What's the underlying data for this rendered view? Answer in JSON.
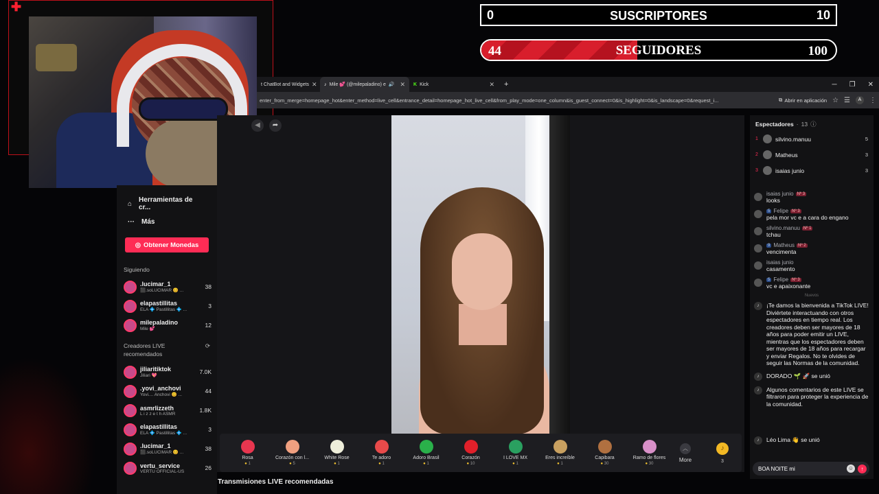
{
  "counters": {
    "subscribers": {
      "current": "0",
      "label": "SUSCRIPTORES",
      "goal": "10"
    },
    "followers": {
      "current": "44",
      "label": "SEGUIDORES",
      "goal": "100",
      "progress": 0.44
    }
  },
  "browser": {
    "tabs": [
      {
        "label": "t ChatBot and Widgets",
        "active": false
      },
      {
        "label": "Mile 💕 (@milepaladino) e",
        "active": true
      },
      {
        "label": "Kick",
        "active": false
      }
    ],
    "url": "enter_from_merge=homepage_hot&enter_method=live_cell&entrance_detail=homepage_hot_live_cell&from_play_mode=one_column&is_guest_connect=0&is_highlight=0&is_landscape=0&request_i...",
    "open_app_label": "Abrir en aplicación"
  },
  "leftnav": {
    "items": [
      {
        "label": "Herramientas de cr...",
        "icon": "home-icon"
      },
      {
        "label": "Más",
        "icon": "ellipsis-icon"
      }
    ],
    "coins_button": "Obtener Monedas",
    "following_title": "Siguiendo",
    "following": [
      {
        "name": ".lucimar_1",
        "sub": "⬛.soLUCIMAR 😊 ...",
        "count": "38"
      },
      {
        "name": "elapastillitas",
        "sub": "ELA 💠 Pastillitas 💠 ...",
        "count": "3"
      },
      {
        "name": "milepaladino",
        "sub": "Mile 💕",
        "count": "12"
      }
    ],
    "recommended_title": "Creadores LIVE recomendados",
    "recommended": [
      {
        "name": "jiliaritiktok",
        "sub": "Jiliari 💖",
        "count": "7.0K"
      },
      {
        "name": ".yovi_anchovi",
        "sub": "Yovi.... Anchovi 😊 ...",
        "count": "44"
      },
      {
        "name": "asmrlizzeth",
        "sub": "L i z z e t h ASMR",
        "count": "1.8K"
      },
      {
        "name": "elapastillitas",
        "sub": "ELA 💠 Pastillitas 💠 ...",
        "count": "3"
      },
      {
        "name": ".lucimar_1",
        "sub": "⬛.soLUCIMAR 😊 ...",
        "count": "38"
      },
      {
        "name": "vertu_service",
        "sub": "VERTU OFFICIAL-US",
        "count": "26"
      }
    ]
  },
  "gifts": [
    {
      "name": "Rosa",
      "price": "1",
      "color": "#e8364f"
    },
    {
      "name": "Corazón con l...",
      "price": "5",
      "color": "#f0a080"
    },
    {
      "name": "White Rose",
      "price": "1",
      "color": "#eeeeda"
    },
    {
      "name": "Te adoro",
      "price": "1",
      "color": "#e84a4a"
    },
    {
      "name": "Adoro Brasil",
      "price": "1",
      "color": "#2ab04a"
    },
    {
      "name": "Corazón",
      "price": "10",
      "color": "#e0202a"
    },
    {
      "name": "I LOVE MX",
      "price": "1",
      "color": "#2aa060"
    },
    {
      "name": "Eres increíble",
      "price": "1",
      "color": "#c8a060"
    },
    {
      "name": "Capibara",
      "price": "30",
      "color": "#b07040"
    },
    {
      "name": "Ramo de flores",
      "price": "30",
      "color": "#d890c8"
    }
  ],
  "gift_more": "More",
  "coin_balance": "3",
  "recommended_live": "Transmisiones LIVE recomendadas",
  "spectators": {
    "title": "Espectadores",
    "count": "13",
    "list": [
      {
        "rank": "1",
        "name": "silvino.manuu",
        "score": "5"
      },
      {
        "rank": "2",
        "name": "Matheus",
        "score": "3"
      },
      {
        "rank": "3",
        "name": "isaias junio",
        "score": "3"
      }
    ]
  },
  "chat": [
    {
      "user": "isaias junio",
      "badge": "Nº 3",
      "text": "looks"
    },
    {
      "user": "Felipe",
      "level": "5",
      "badge": "Nº 3",
      "text": "pela mor vc e a cara do engano"
    },
    {
      "user": "silvino.manuu",
      "badge": "Nº 1",
      "text": "tchau"
    },
    {
      "user": "Matheus",
      "level": "9",
      "badge": "Nº 2",
      "text": "vencimenta"
    },
    {
      "user": "isaias junio",
      "text": "casamento"
    },
    {
      "user": "Felipe",
      "level": "5",
      "badge": "Nº 3",
      "text": "vc e apaixonante"
    }
  ],
  "chat_divider": "Nuevos",
  "system_msgs": [
    "¡Te damos la bienvenida a TikTok LIVE! Diviértete interactuando con otros espectadores en tiempo real. Los creadores deben ser mayores de 18 años para poder emitir un LIVE, mientras que los espectadores deben ser mayores de 18 años para recargar y enviar Regalos. No te olvides de seguir las Normas de la comunidad.",
    "DORADO 🌱 🚀  se unió",
    "Algunos comentarios de este LIVE se filtraron para proteger la experiencia de la comunidad.",
    "Léo Lima 👋  se unió"
  ],
  "chat_input_value": "BOA NOITE mi"
}
